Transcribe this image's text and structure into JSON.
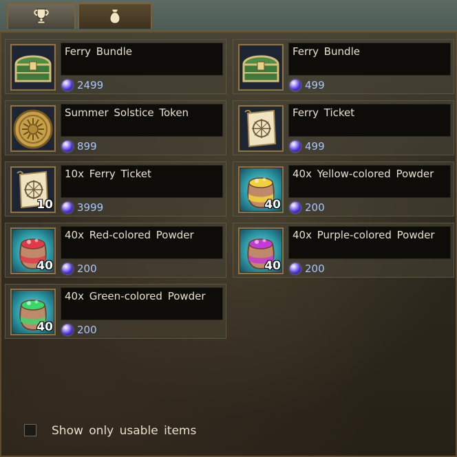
{
  "tabs": [
    {
      "icon": "trophy-icon"
    },
    {
      "icon": "money-bag-icon"
    }
  ],
  "items": [
    {
      "name": "Ferry Bundle",
      "price": "2499",
      "icon": "chest-icon",
      "qty": ""
    },
    {
      "name": "Ferry Bundle",
      "price": "499",
      "icon": "chest-icon",
      "qty": ""
    },
    {
      "name": "Summer Solstice Token",
      "price": "899",
      "icon": "coin-icon",
      "qty": ""
    },
    {
      "name": "Ferry Ticket",
      "price": "499",
      "icon": "ticket-scroll-icon",
      "qty": ""
    },
    {
      "name": "10x Ferry Ticket",
      "price": "3999",
      "icon": "ticket-scroll-icon",
      "qty": "10"
    },
    {
      "name": "40x Yellow-colored Powder",
      "price": "200",
      "icon": "powder-bag-yellow-icon",
      "qty": "40"
    },
    {
      "name": "40x Red-colored Powder",
      "price": "200",
      "icon": "powder-bag-red-icon",
      "qty": "40"
    },
    {
      "name": "40x Purple-colored Powder",
      "price": "200",
      "icon": "powder-bag-purple-icon",
      "qty": "40"
    },
    {
      "name": "40x Green-colored Powder",
      "price": "200",
      "icon": "powder-bag-green-icon",
      "qty": "40"
    }
  ],
  "filter": {
    "label": "Show only usable items",
    "checked": false
  },
  "colors": {
    "powder_yellow": "#f2d23a",
    "powder_red": "#e03a4a",
    "powder_purple": "#c43ad6",
    "powder_green": "#3ad86a",
    "price_text": "#a8c8ff"
  }
}
